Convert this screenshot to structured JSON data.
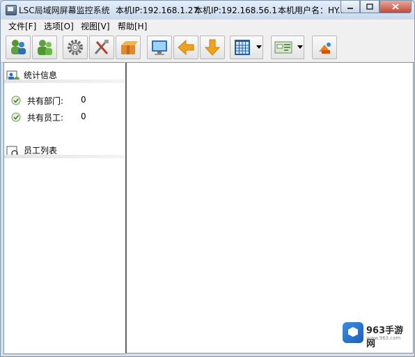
{
  "window": {
    "title": "LSC局域网屏幕监控系统",
    "ip_1": "本机IP:192.168.1.27",
    "ip_2": "本机IP:192.168.56.1",
    "user": "本机用户名：HY..."
  },
  "menu": [
    {
      "label": "文件[F]"
    },
    {
      "label": "选项[O]"
    },
    {
      "label": "视图[V]"
    },
    {
      "label": "帮助[H]"
    }
  ],
  "toolbar": {
    "buttons": [
      {
        "icon": "add-users-icon"
      },
      {
        "icon": "users-icon"
      },
      {
        "icon": "gear-icon"
      },
      {
        "icon": "tools-icon"
      },
      {
        "icon": "package-icon"
      },
      {
        "icon": "monitor-icon"
      },
      {
        "icon": "arrow-left-icon"
      },
      {
        "icon": "arrow-down-icon"
      },
      {
        "icon": "grid-layout-icon"
      },
      {
        "icon": "network-card-icon"
      },
      {
        "icon": "exit-icon"
      }
    ]
  },
  "stats": {
    "heading": "统计信息",
    "departments_label": "共有部门:",
    "departments_value": "0",
    "employees_label": "共有员工:",
    "employees_value": "0"
  },
  "employees": {
    "heading": "员工列表"
  },
  "watermark": {
    "brand": "963手游网",
    "site": "www.963.com"
  },
  "colors": {
    "titlebar": "#c9daed",
    "pane_background": "#ffffff",
    "ok_green": "#5aa53a",
    "accent_orange": "#f0a21c"
  }
}
